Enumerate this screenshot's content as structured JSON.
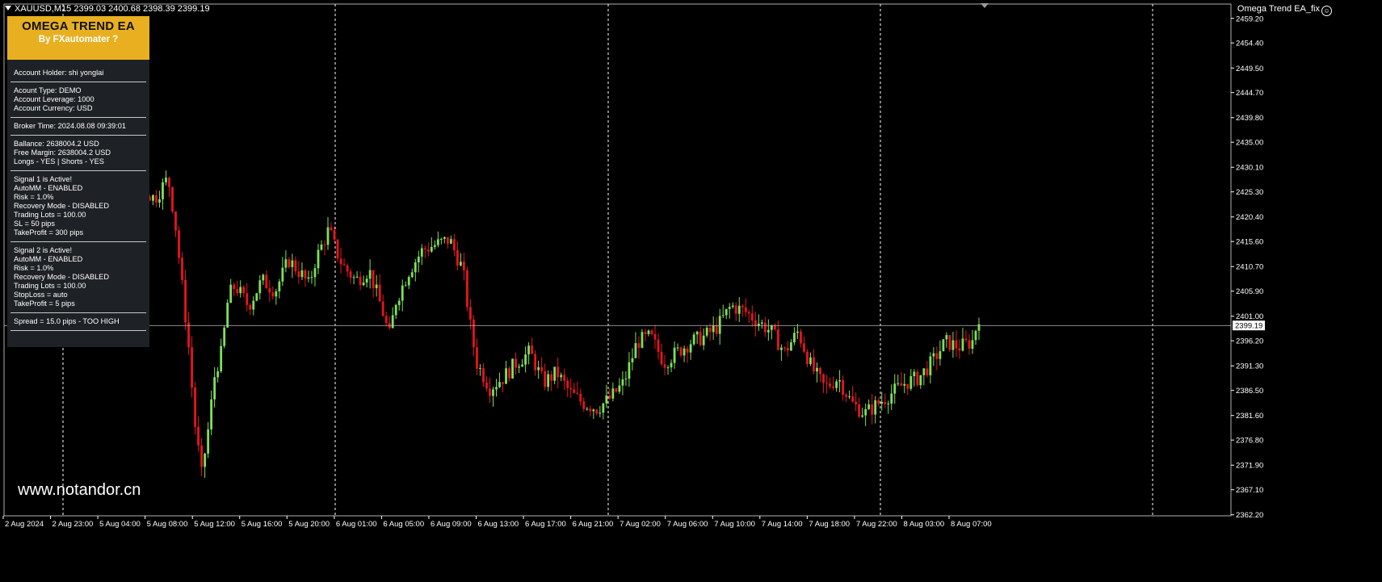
{
  "header": {
    "symbol_text": "XAUUSD,M15  2399.03 2400.68 2398.39 2399.19",
    "ea_label": "Omega Trend EA_fix"
  },
  "panel": {
    "title": "OMEGA TREND EA",
    "subtitle": "By FXautomater ?",
    "groups": [
      [
        "Account Holder: shi yonglai"
      ],
      [
        "Acount Type:  DEMO",
        "Account Leverage: 1000",
        "Account Currency: USD"
      ],
      [
        "Broker Time: 2024.08.08 09:39:01"
      ],
      [
        "Ballance: 2638004.2 USD",
        "Free Margin: 2638004.2 USD",
        "Longs - YES  |  Shorts - YES"
      ],
      [
        "Signal 1 is Active!",
        "AutoMM - ENABLED",
        "Risk = 1.0%",
        "Recovery Mode - DISABLED",
        "Trading Lots = 100.00",
        "SL = 50 pips",
        "TakeProfit = 300 pips"
      ],
      [
        "Signal 2 is Active!",
        "AutoMM - ENABLED",
        "Risk = 1.0%",
        "Recovery Mode - DISABLED",
        "Trading Lots = 100.00",
        "StopLoss = auto",
        "TakeProfit = 5 pips"
      ],
      [
        "Spread = 15.0 pips - TOO HIGH"
      ]
    ]
  },
  "watermark": "www.notandor.cn",
  "colors": {
    "bull": "#7ee05a",
    "bear": "#e8141e",
    "grid": "#ffffff",
    "panel_header": "#e8b020",
    "panel_bg": "#1e2226"
  },
  "chart_data": {
    "type": "candlestick",
    "symbol": "XAUUSD",
    "timeframe": "M15",
    "ylim": [
      2362.0,
      2462.0
    ],
    "y_ticks": [
      2459.2,
      2454.4,
      2449.5,
      2444.7,
      2439.8,
      2435.0,
      2430.1,
      2425.3,
      2420.4,
      2415.6,
      2410.7,
      2405.9,
      2401.0,
      2396.2,
      2391.3,
      2386.5,
      2381.6,
      2376.8,
      2371.9,
      2367.1,
      2362.2
    ],
    "current_price": 2399.19,
    "current_price_label": "2399.19",
    "x_labels": [
      "2 Aug 2024",
      "2 Aug 23:00",
      "5 Aug 04:00",
      "5 Aug 08:00",
      "5 Aug 12:00",
      "5 Aug 16:00",
      "5 Aug 20:00",
      "6 Aug 01:00",
      "6 Aug 05:00",
      "6 Aug 09:00",
      "6 Aug 13:00",
      "6 Aug 17:00",
      "6 Aug 21:00",
      "7 Aug 02:00",
      "7 Aug 06:00",
      "7 Aug 10:00",
      "7 Aug 14:00",
      "7 Aug 18:00",
      "7 Aug 22:00",
      "8 Aug 03:00",
      "8 Aug 07:00"
    ],
    "separator_label_indices": [
      1,
      7,
      12,
      18
    ],
    "path": [
      [
        0,
        2437
      ],
      [
        3,
        2449
      ],
      [
        5,
        2446
      ],
      [
        8,
        2435
      ],
      [
        10,
        2426
      ],
      [
        12,
        2430
      ],
      [
        14,
        2438
      ],
      [
        16,
        2444
      ],
      [
        18,
        2433
      ],
      [
        20,
        2426
      ],
      [
        22,
        2424
      ],
      [
        24,
        2428
      ],
      [
        25,
        2420
      ],
      [
        26,
        2408
      ],
      [
        27,
        2396
      ],
      [
        28,
        2380
      ],
      [
        29,
        2370
      ],
      [
        30,
        2379
      ],
      [
        31,
        2390
      ],
      [
        32,
        2394
      ],
      [
        33,
        2405
      ],
      [
        34,
        2407
      ],
      [
        36,
        2403
      ],
      [
        38,
        2408
      ],
      [
        40,
        2406
      ],
      [
        42,
        2412
      ],
      [
        44,
        2409
      ],
      [
        45,
        2407
      ],
      [
        46,
        2412
      ],
      [
        48,
        2418
      ],
      [
        49,
        2414
      ],
      [
        50,
        2411
      ],
      [
        52,
        2408
      ],
      [
        54,
        2410
      ],
      [
        56,
        2402
      ],
      [
        57,
        2397
      ],
      [
        58,
        2404
      ],
      [
        60,
        2410
      ],
      [
        62,
        2414
      ],
      [
        64,
        2415
      ],
      [
        66,
        2416
      ],
      [
        68,
        2410
      ],
      [
        69,
        2400
      ],
      [
        70,
        2392
      ],
      [
        72,
        2387
      ],
      [
        74,
        2389
      ],
      [
        76,
        2392
      ],
      [
        78,
        2394
      ],
      [
        80,
        2388
      ],
      [
        82,
        2390
      ],
      [
        84,
        2386
      ],
      [
        86,
        2384
      ],
      [
        88,
        2383
      ],
      [
        90,
        2385
      ],
      [
        92,
        2388
      ],
      [
        94,
        2396
      ],
      [
        96,
        2397
      ],
      [
        98,
        2392
      ],
      [
        100,
        2394
      ],
      [
        102,
        2396
      ],
      [
        104,
        2397
      ],
      [
        106,
        2399
      ],
      [
        108,
        2403
      ],
      [
        110,
        2402
      ],
      [
        112,
        2400
      ],
      [
        114,
        2398
      ],
      [
        116,
        2394
      ],
      [
        118,
        2398
      ],
      [
        120,
        2391
      ],
      [
        122,
        2387
      ],
      [
        124,
        2389
      ],
      [
        126,
        2384
      ],
      [
        128,
        2382
      ],
      [
        130,
        2384
      ],
      [
        132,
        2386
      ],
      [
        134,
        2388
      ],
      [
        136,
        2389
      ],
      [
        138,
        2392
      ],
      [
        140,
        2396
      ],
      [
        142,
        2395
      ],
      [
        144,
        2396
      ],
      [
        145,
        2401
      ]
    ]
  }
}
